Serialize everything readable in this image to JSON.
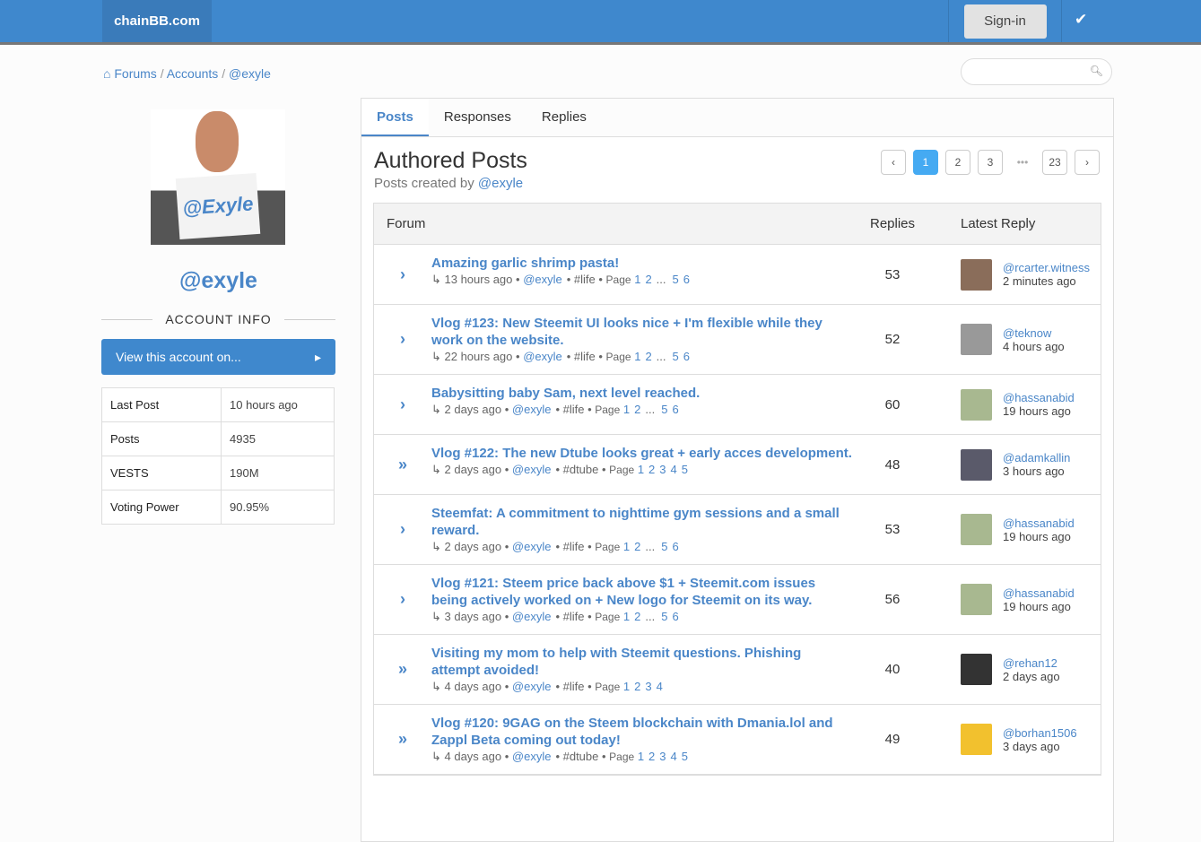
{
  "header": {
    "brand": "chainBB.com",
    "signin": "Sign-in",
    "check_icon": "✔"
  },
  "breadcrumb": [
    "Forums",
    "Accounts",
    "@exyle"
  ],
  "profile": {
    "avatar_text": "@Exyle",
    "username": "@exyle",
    "account_info": "ACCOUNT INFO",
    "view_button": "View this account on...",
    "stats": [
      {
        "label": "Last Post",
        "value": "10 hours ago"
      },
      {
        "label": "Posts",
        "value": "4935"
      },
      {
        "label": "VESTS",
        "value": "190M"
      },
      {
        "label": "Voting Power",
        "value": "90.95%"
      }
    ]
  },
  "tabs": [
    "Posts",
    "Responses",
    "Replies"
  ],
  "main": {
    "title": "Authored Posts",
    "subtitle_prefix": "Posts created by",
    "subtitle_user": "@exyle",
    "pager": [
      "‹",
      "1",
      "2",
      "3",
      "•••",
      "23",
      "›"
    ],
    "columns": {
      "forum": "Forum",
      "replies": "Replies",
      "latest": "Latest Reply"
    },
    "rows": [
      {
        "icon": "›",
        "title": "Amazing garlic shrimp pasta!",
        "time": "↳ 13 hours ago",
        "author": "@exyle",
        "tag": "#life",
        "pages": [
          "1",
          "2",
          "...",
          "5",
          "6"
        ],
        "replies": "53",
        "user": "@rcarter.witness",
        "ago": "2 minutes ago",
        "color": "#8a6d5a"
      },
      {
        "icon": "›",
        "title": "Vlog #123: New Steemit UI looks nice + I'm flexible while they work on the website.",
        "time": "↳ 22 hours ago",
        "author": "@exyle",
        "tag": "#life",
        "pages": [
          "1",
          "2",
          "...",
          "5",
          "6"
        ],
        "replies": "52",
        "user": "@teknow",
        "ago": "4 hours ago",
        "color": "#999"
      },
      {
        "icon": "›",
        "title": "Babysitting baby Sam, next level reached.",
        "time": "↳ 2 days ago",
        "author": "@exyle",
        "tag": "#life",
        "pages": [
          "1",
          "2",
          "...",
          "5",
          "6"
        ],
        "replies": "60",
        "user": "@hassanabid",
        "ago": "19 hours ago",
        "color": "#a8b890"
      },
      {
        "icon": "»",
        "title": "Vlog #122: The new Dtube looks great + early acces development.",
        "time": "↳ 2 days ago",
        "author": "@exyle",
        "tag": "#dtube",
        "pages": [
          "1",
          "2",
          "3",
          "4",
          "5"
        ],
        "replies": "48",
        "user": "@adamkallin",
        "ago": "3 hours ago",
        "color": "#5a5a6a"
      },
      {
        "icon": "›",
        "title": "Steemfat: A commitment to nighttime gym sessions and a small reward.",
        "time": "↳ 2 days ago",
        "author": "@exyle",
        "tag": "#life",
        "pages": [
          "1",
          "2",
          "...",
          "5",
          "6"
        ],
        "replies": "53",
        "user": "@hassanabid",
        "ago": "19 hours ago",
        "color": "#a8b890"
      },
      {
        "icon": "›",
        "title": "Vlog #121: Steem price back above $1 + Steemit.com issues being actively worked on + New logo for Steemit on its way.",
        "time": "↳ 3 days ago",
        "author": "@exyle",
        "tag": "#life",
        "pages": [
          "1",
          "2",
          "...",
          "5",
          "6"
        ],
        "replies": "56",
        "user": "@hassanabid",
        "ago": "19 hours ago",
        "color": "#a8b890"
      },
      {
        "icon": "»",
        "title": "Visiting my mom to help with Steemit questions. Phishing attempt avoided!",
        "time": "↳ 4 days ago",
        "author": "@exyle",
        "tag": "#life",
        "pages": [
          "1",
          "2",
          "3",
          "4"
        ],
        "replies": "40",
        "user": "@rehan12",
        "ago": "2 days ago",
        "color": "#333"
      },
      {
        "icon": "»",
        "title": "Vlog #120: 9GAG on the Steem blockchain with Dmania.lol and Zappl Beta coming out today!",
        "time": "↳ 4 days ago",
        "author": "@exyle",
        "tag": "#dtube",
        "pages": [
          "1",
          "2",
          "3",
          "4",
          "5"
        ],
        "replies": "49",
        "user": "@borhan1506",
        "ago": "3 days ago",
        "color": "#f2c12e"
      }
    ]
  }
}
